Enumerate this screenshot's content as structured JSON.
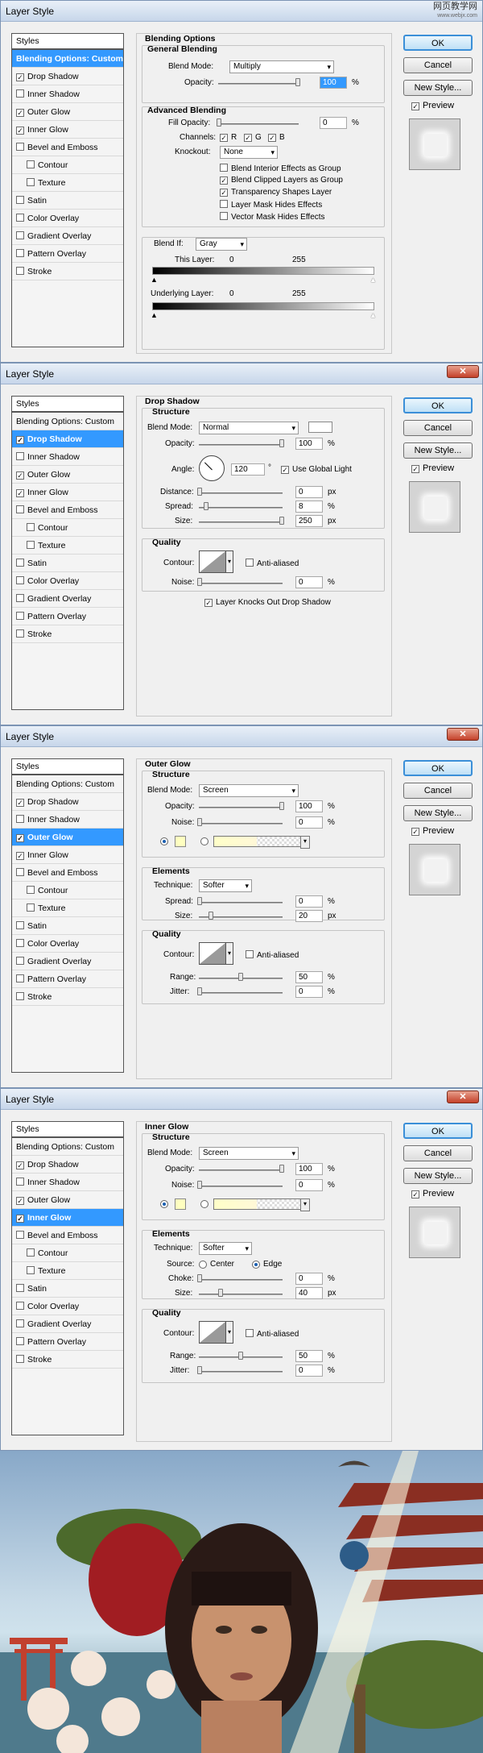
{
  "watermark": {
    "text": "网页教学网",
    "sub": "www.webjx.com"
  },
  "dialog_title": "Layer Style",
  "styles_header": "Styles",
  "styles_list": [
    {
      "label": "Blending Options: Custom",
      "checkbox": false,
      "checked": false
    },
    {
      "label": "Drop Shadow",
      "checkbox": true,
      "checked": true
    },
    {
      "label": "Inner Shadow",
      "checkbox": true,
      "checked": false
    },
    {
      "label": "Outer Glow",
      "checkbox": true,
      "checked": true
    },
    {
      "label": "Inner Glow",
      "checkbox": true,
      "checked": true
    },
    {
      "label": "Bevel and Emboss",
      "checkbox": true,
      "checked": false
    },
    {
      "label": "Contour",
      "checkbox": true,
      "checked": false,
      "sub": true
    },
    {
      "label": "Texture",
      "checkbox": true,
      "checked": false,
      "sub": true
    },
    {
      "label": "Satin",
      "checkbox": true,
      "checked": false
    },
    {
      "label": "Color Overlay",
      "checkbox": true,
      "checked": false
    },
    {
      "label": "Gradient Overlay",
      "checkbox": true,
      "checked": false
    },
    {
      "label": "Pattern Overlay",
      "checkbox": true,
      "checked": false
    },
    {
      "label": "Stroke",
      "checkbox": true,
      "checked": false
    }
  ],
  "buttons": {
    "ok": "OK",
    "cancel": "Cancel",
    "new_style": "New Style...",
    "preview": "Preview"
  },
  "blending": {
    "title": "Blending Options",
    "general": "General Blending",
    "blend_mode_label": "Blend Mode:",
    "blend_mode": "Multiply",
    "opacity_label": "Opacity:",
    "opacity": "100",
    "pct": "%",
    "advanced": "Advanced Blending",
    "fill_label": "Fill Opacity:",
    "fill": "0",
    "channels_label": "Channels:",
    "ch_r": "R",
    "ch_g": "G",
    "ch_b": "B",
    "knockout_label": "Knockout:",
    "knockout": "None",
    "opt1": "Blend Interior Effects as Group",
    "opt2": "Blend Clipped Layers as Group",
    "opt3": "Transparency Shapes Layer",
    "opt4": "Layer Mask Hides Effects",
    "opt5": "Vector Mask Hides Effects",
    "blendif_label": "Blend If:",
    "blendif": "Gray",
    "this_layer": "This Layer:",
    "under_layer": "Underlying Layer:",
    "v0": "0",
    "v255": "255"
  },
  "drop_shadow": {
    "title": "Drop Shadow",
    "structure": "Structure",
    "blend_mode_label": "Blend Mode:",
    "blend_mode": "Normal",
    "opacity_label": "Opacity:",
    "opacity": "100",
    "pct": "%",
    "angle_label": "Angle:",
    "angle": "120",
    "deg": "°",
    "global_light": "Use Global Light",
    "distance_label": "Distance:",
    "distance": "0",
    "px": "px",
    "spread_label": "Spread:",
    "spread": "8",
    "size_label": "Size:",
    "size": "250",
    "quality": "Quality",
    "contour_label": "Contour:",
    "anti": "Anti-aliased",
    "noise_label": "Noise:",
    "noise": "0",
    "knocks": "Layer Knocks Out Drop Shadow"
  },
  "outer_glow": {
    "title": "Outer Glow",
    "structure": "Structure",
    "blend_mode_label": "Blend Mode:",
    "blend_mode": "Screen",
    "opacity_label": "Opacity:",
    "opacity": "100",
    "pct": "%",
    "noise_label": "Noise:",
    "noise": "0",
    "elements": "Elements",
    "technique_label": "Technique:",
    "technique": "Softer",
    "spread_label": "Spread:",
    "spread": "0",
    "size_label": "Size:",
    "size": "20",
    "px": "px",
    "quality": "Quality",
    "contour_label": "Contour:",
    "anti": "Anti-aliased",
    "range_label": "Range:",
    "range": "50",
    "jitter_label": "Jitter:",
    "jitter": "0",
    "glow_color": "#ffffc0"
  },
  "inner_glow": {
    "title": "Inner Glow",
    "structure": "Structure",
    "blend_mode_label": "Blend Mode:",
    "blend_mode": "Screen",
    "opacity_label": "Opacity:",
    "opacity": "100",
    "pct": "%",
    "noise_label": "Noise:",
    "noise": "0",
    "elements": "Elements",
    "technique_label": "Technique:",
    "technique": "Softer",
    "source_label": "Source:",
    "center": "Center",
    "edge": "Edge",
    "choke_label": "Choke:",
    "choke": "0",
    "size_label": "Size:",
    "size": "40",
    "px": "px",
    "quality": "Quality",
    "contour_label": "Contour:",
    "anti": "Anti-aliased",
    "range_label": "Range:",
    "range": "50",
    "jitter_label": "Jitter:",
    "jitter": "0",
    "glow_color": "#ffffc0"
  }
}
